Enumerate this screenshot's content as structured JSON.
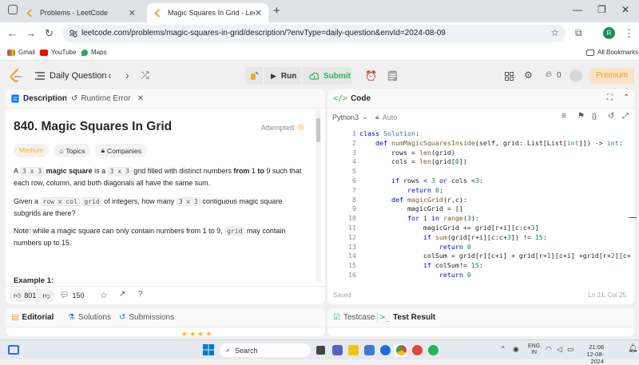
{
  "browser": {
    "tabs": [
      {
        "title": "Problems - LeetCode"
      },
      {
        "title": "Magic Squares In Grid - LeetCode"
      }
    ],
    "url": "leetcode.com/problems/magic-squares-in-grid/description/?envType=daily-question&envId=2024-08-09",
    "profile_initial": "R",
    "bookmarks": [
      "Gmail",
      "YouTube",
      "Maps"
    ],
    "all_bookmarks": "All Bookmarks"
  },
  "header": {
    "daily_question": "Daily Question",
    "run": "Run",
    "submit": "Submit",
    "streak_count": "0",
    "premium": "Premium"
  },
  "left_panel": {
    "tabs": {
      "description": "Description",
      "runtime_error": "Runtime Error"
    },
    "title": "840. Magic Squares In Grid",
    "status": "Attempted",
    "tags": {
      "difficulty": "Medium",
      "topics": "Topics",
      "companies": "Companies"
    },
    "p1": {
      "a": "A ",
      "c1": "3 x 3",
      "b": " ",
      "bold1": "magic square",
      "c": " is a ",
      "c2": "3 x 3",
      "d": " grid filled with distinct numbers ",
      "bold2": "from",
      "e": " 1 ",
      "bold3": "to",
      "f": " 9 such that each row, column, and both diagonals all have the same sum."
    },
    "p2": {
      "a": "Given a ",
      "c1": "row x col",
      "b": " ",
      "c2": "grid",
      "c": " of integers, how many ",
      "c3": "3 x 3",
      "d": " contiguous magic square subgrids are there?"
    },
    "p3": {
      "a": "Note: while a magic square can only contain numbers from 1 to 9, ",
      "c1": "grid",
      "b": " may contain numbers up to 15."
    },
    "example": "Example 1:",
    "likes": "801",
    "comments": "150"
  },
  "bottom_left_tabs": {
    "editorial": "Editorial",
    "solutions": "Solutions",
    "submissions": "Submissions"
  },
  "code_panel": {
    "title": "Code",
    "language": "Python3",
    "auto": "Auto",
    "saved": "Saved",
    "cursor": "Ln 21, Col 25",
    "line_numbers": [
      "1",
      "2",
      "3",
      "4",
      "5",
      "6",
      "7",
      "8",
      "9",
      "10",
      "11",
      "12",
      "13",
      "14",
      "15",
      "16"
    ]
  },
  "bottom_right_tabs": {
    "testcase": "Testcase",
    "test_result": "Test Result"
  },
  "taskbar": {
    "search": "Search",
    "lang": "ENG",
    "region": "IN",
    "time": "21:08",
    "date": "12-08-2024"
  },
  "colors": {
    "accent_orange": "#ffa116",
    "run_green": "#2db55d",
    "keyword_blue": "#0000ff",
    "medium_yellow": "#ffb800"
  },
  "icons": [
    "leetcode-logo-icon",
    "list-icon",
    "shuffle-icon",
    "play-icon",
    "upload-icon",
    "clock-icon",
    "note-icon",
    "layout-icon",
    "gear-icon",
    "fire-icon",
    "user-icon",
    "thumb-up-icon",
    "thumb-down-icon",
    "comment-icon",
    "star-icon",
    "share-icon",
    "help-icon"
  ]
}
